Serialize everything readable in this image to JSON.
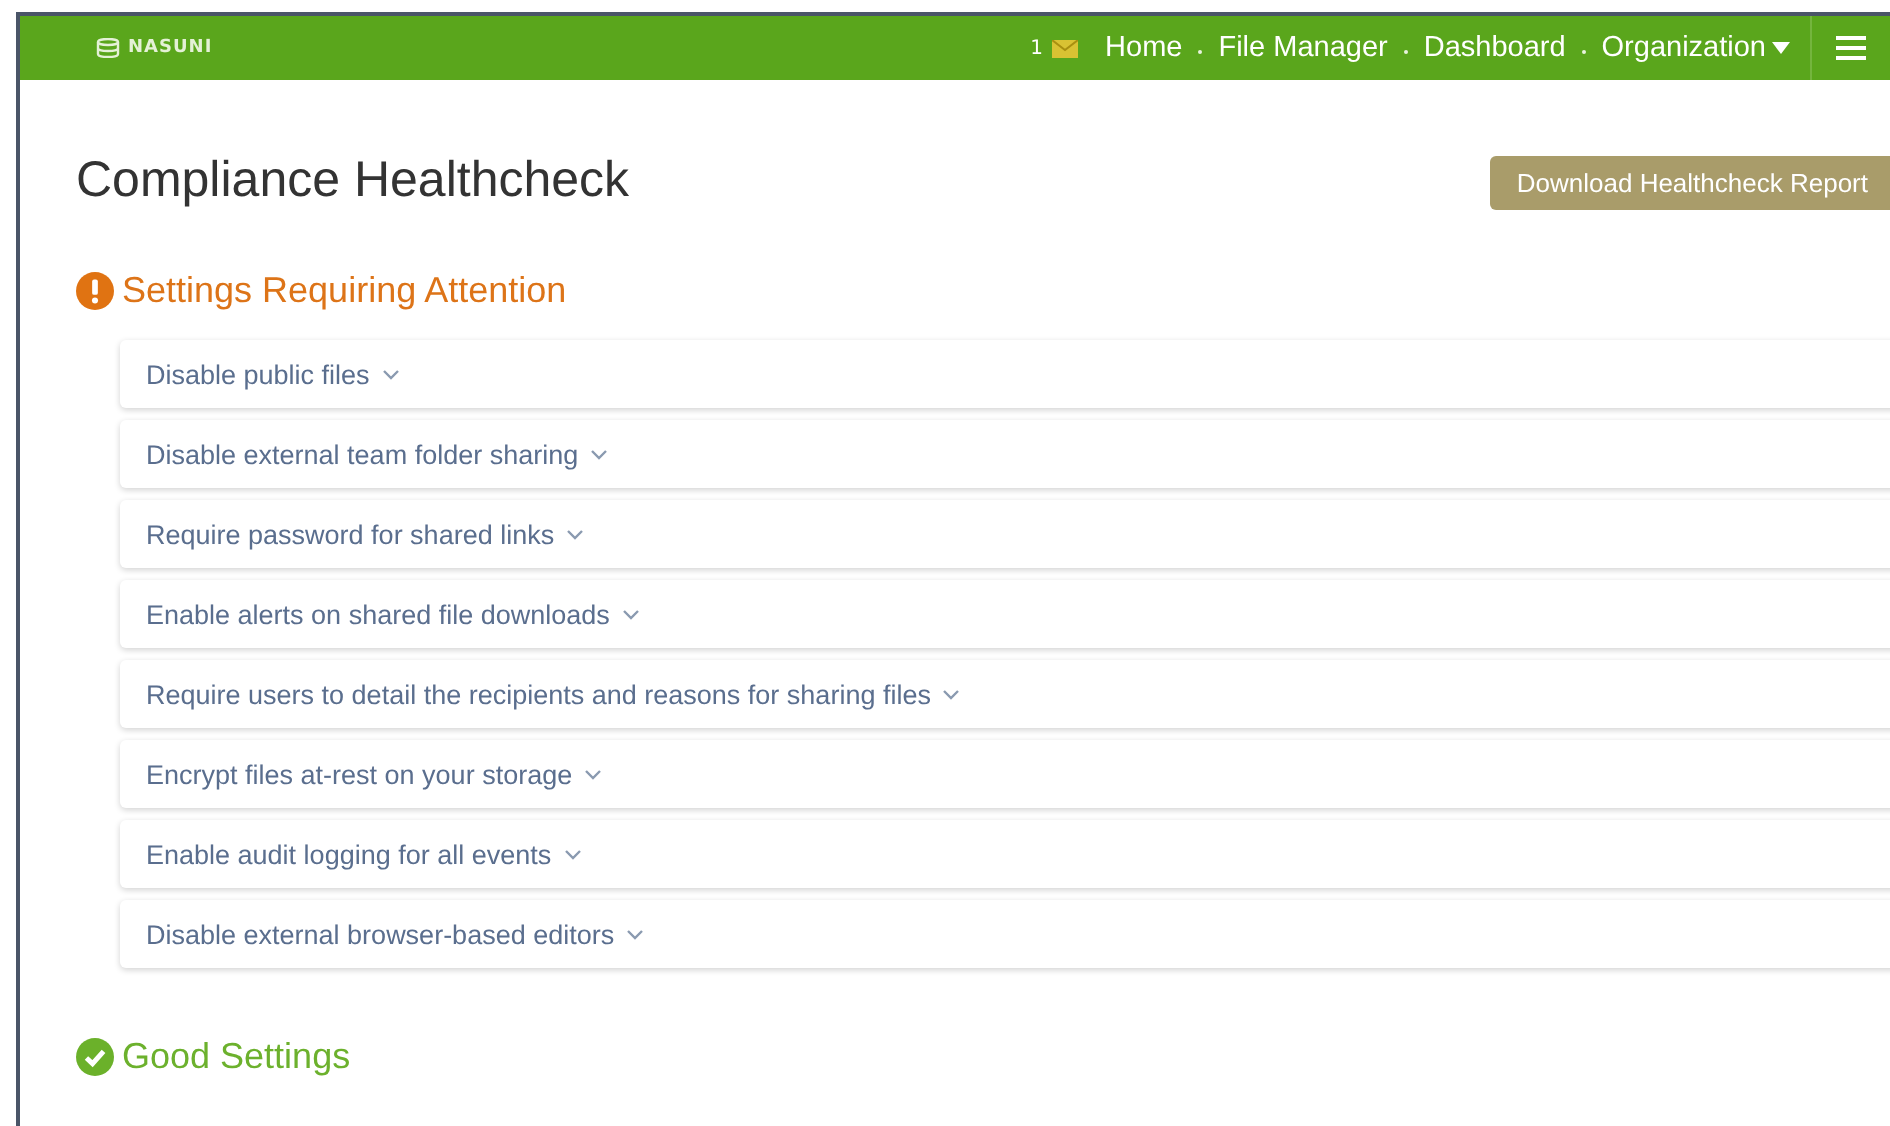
{
  "header": {
    "logo": "NASUNI",
    "message_count": "1",
    "nav": [
      {
        "label": "Home",
        "has_menu": false
      },
      {
        "label": "File Manager",
        "has_menu": false
      },
      {
        "label": "Dashboard",
        "has_menu": false
      },
      {
        "label": "Organization",
        "has_menu": true
      }
    ]
  },
  "page": {
    "title": "Compliance Healthcheck",
    "download_button": "Download Healthcheck Report"
  },
  "sections": [
    {
      "kind": "attention",
      "title": "Settings Requiring Attention",
      "items": [
        {
          "label": "Disable public files",
          "expanded": false
        },
        {
          "label": "Disable external team folder sharing",
          "expanded": false
        },
        {
          "label": "Require password for shared links",
          "expanded": false
        },
        {
          "label": "Enable alerts on shared file downloads",
          "expanded": false
        },
        {
          "label": "Require users to detail the recipients and reasons for sharing files",
          "expanded": false
        },
        {
          "label": "Encrypt files at-rest on your storage",
          "expanded": false
        },
        {
          "label": "Enable audit logging for all events",
          "expanded": false
        },
        {
          "label": "Disable external browser-based editors",
          "expanded": false
        }
      ]
    },
    {
      "kind": "good",
      "title": "Good Settings"
    }
  ]
}
